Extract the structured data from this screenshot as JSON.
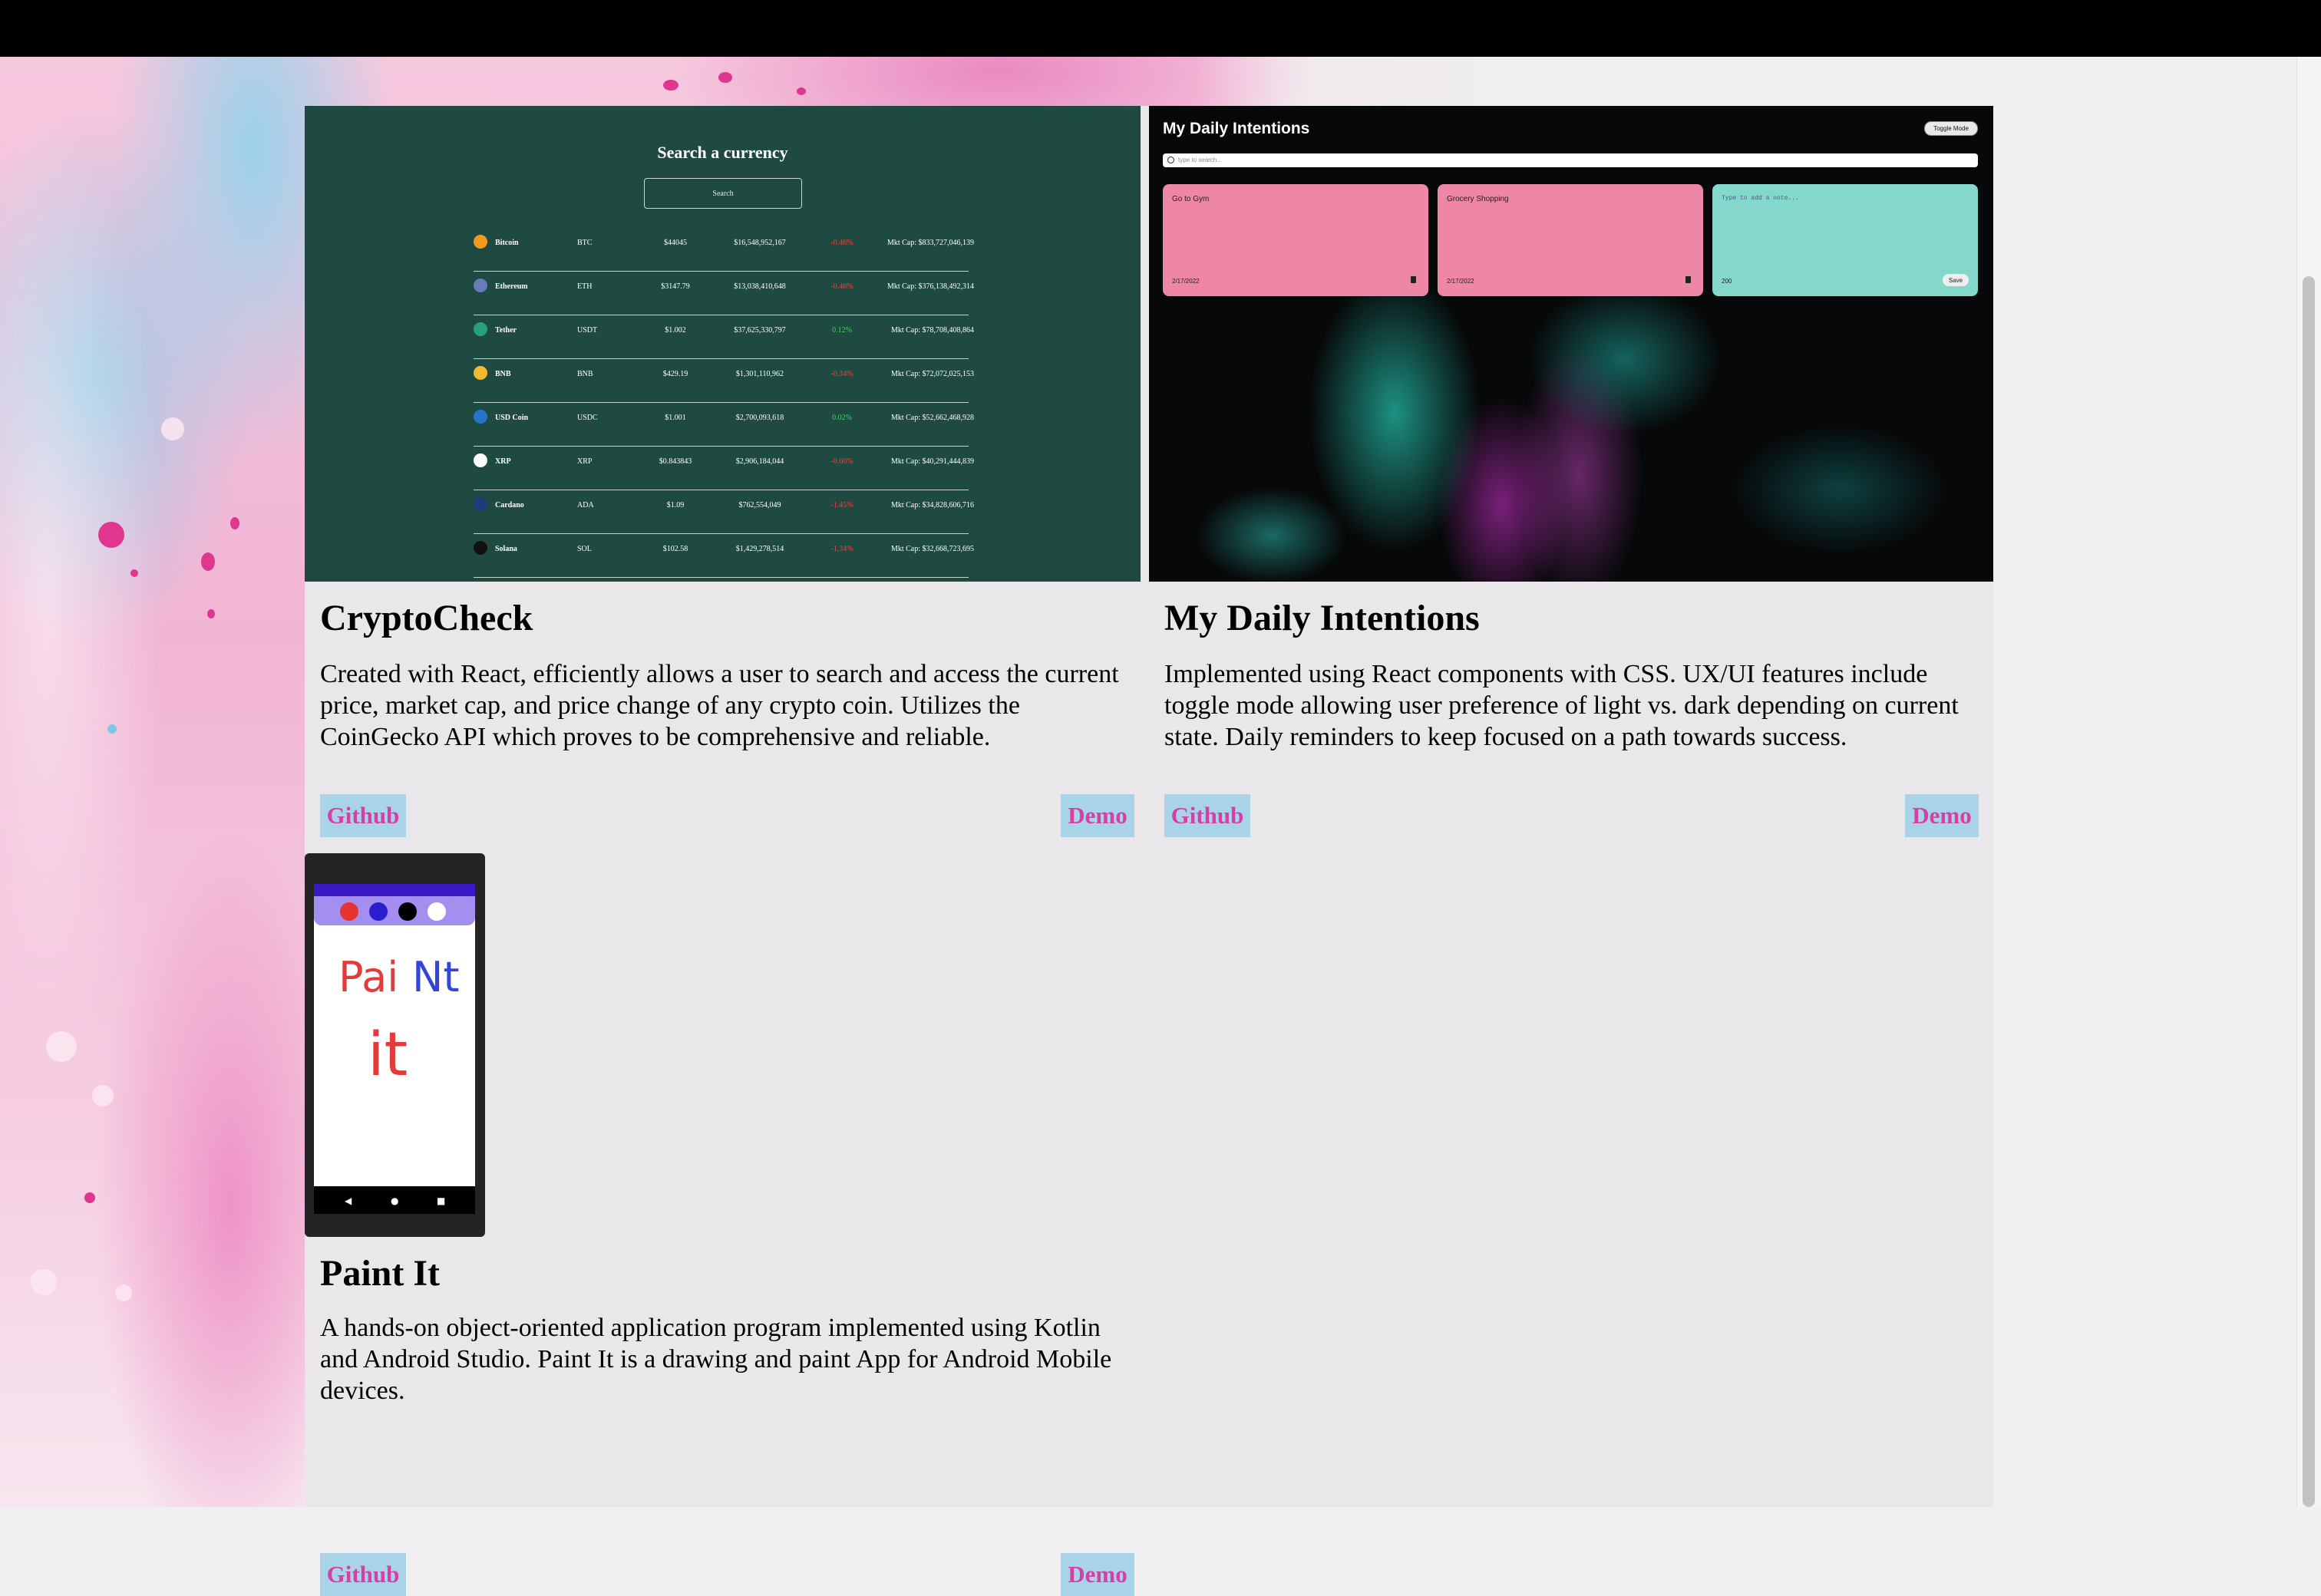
{
  "projects": [
    {
      "title": "CryptoCheck",
      "description": "Created with React, efficiently allows a user to search and access the current price, market cap, and price change of any crypto coin. Utilizes the CoinGecko API which proves to be comprehensive and reliable.",
      "github_label": "Github",
      "demo_label": "Demo",
      "preview": {
        "heading": "Search a currency",
        "search_placeholder": "Search",
        "coins": [
          {
            "name": "Bitcoin",
            "symbol": "BTC",
            "price": "$44045",
            "volume": "$16,548,952,167",
            "change": "-0.46%",
            "direction": "down",
            "market_cap": "Mkt Cap: $833,727,046,139",
            "color": "#f39a1e"
          },
          {
            "name": "Ethereum",
            "symbol": "ETH",
            "price": "$3147.79",
            "volume": "$13,038,410,648",
            "change": "-0.46%",
            "direction": "down",
            "market_cap": "Mkt Cap: $376,138,492,314",
            "color": "#6b7ab8"
          },
          {
            "name": "Tether",
            "symbol": "USDT",
            "price": "$1.002",
            "volume": "$37,625,330,797",
            "change": "0.12%",
            "direction": "up",
            "market_cap": "Mkt Cap: $78,708,408,864",
            "color": "#26a17b"
          },
          {
            "name": "BNB",
            "symbol": "BNB",
            "price": "$429.19",
            "volume": "$1,301,110,962",
            "change": "-0.34%",
            "direction": "down",
            "market_cap": "Mkt Cap: $72,072,025,153",
            "color": "#f3ba2f"
          },
          {
            "name": "USD Coin",
            "symbol": "USDC",
            "price": "$1.001",
            "volume": "$2,700,093,618",
            "change": "0.02%",
            "direction": "up",
            "market_cap": "Mkt Cap: $52,662,468,928",
            "color": "#2775ca"
          },
          {
            "name": "XRP",
            "symbol": "XRP",
            "price": "$0.843843",
            "volume": "$2,906,184,044",
            "change": "-0.60%",
            "direction": "down",
            "market_cap": "Mkt Cap: $40,291,444,839",
            "color": "#ffffff"
          },
          {
            "name": "Cardano",
            "symbol": "ADA",
            "price": "$1.09",
            "volume": "$762,554,049",
            "change": "-1.45%",
            "direction": "down",
            "market_cap": "Mkt Cap: $34,828,606,716",
            "color": "#1c3d7a"
          },
          {
            "name": "Solana",
            "symbol": "SOL",
            "price": "$102.58",
            "volume": "$1,429,278,514",
            "change": "-1.34%",
            "direction": "down",
            "market_cap": "Mkt Cap: $32,668,723,695",
            "color": "#111111"
          }
        ]
      }
    },
    {
      "title": "My Daily Intentions",
      "description": "Implemented using React components with CSS. UX/UI features include toggle mode allowing user preference of light vs. dark depending on current state. Daily reminders to keep focused on a path towards success.",
      "github_label": "Github",
      "demo_label": "Demo",
      "preview": {
        "app_title": "My Daily Intentions",
        "toggle_label": "Toggle Mode",
        "search_placeholder": "type to search...",
        "notes": [
          {
            "text": "Go to Gym",
            "date": "2/17/2022",
            "color": "#ee86a6"
          },
          {
            "text": "Grocery Shopping",
            "date": "2/17/2022",
            "color": "#ee86a6"
          }
        ],
        "new_note": {
          "placeholder": "Type to add a note...",
          "remaining": "200",
          "save_label": "Save",
          "color": "#83d7cb"
        }
      }
    },
    {
      "title": "Paint It",
      "description": "A hands-on object-oriented application program implemented using Kotlin and Android Studio. Paint It is a drawing and paint App for Android Mobile devices.",
      "github_label": "Github",
      "demo_label": "Demo",
      "preview": {
        "drawn_words": [
          "Pai",
          "Nt",
          "it"
        ],
        "palette_colors": [
          "#e8322c",
          "#2a1ed0",
          "#000000",
          "#ffffff"
        ]
      }
    }
  ]
}
